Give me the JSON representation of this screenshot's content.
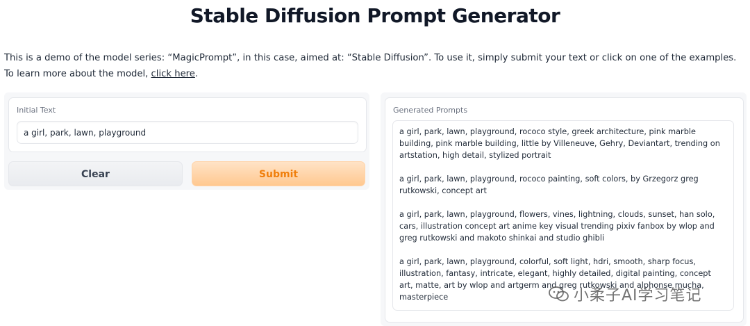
{
  "header": {
    "title": "Stable Diffusion Prompt Generator"
  },
  "description": {
    "text_before_link": "This is a demo of the model series: “MagicPrompt”, in this case, aimed at: “Stable Diffusion”. To use it, simply submit your text or click on one of the examples. To learn more about the model, ",
    "link_label": "click here",
    "text_after_link": "."
  },
  "input_panel": {
    "label": "Initial Text",
    "value": "a girl, park, lawn, playground",
    "clear_label": "Clear",
    "submit_label": "Submit"
  },
  "output_panel": {
    "label": "Generated Prompts",
    "prompts": [
      "a girl, park, lawn, playground, rococo style, greek architecture, pink marble building, pink marble building,  little by Villeneuve, Gehry, Deviantart, trending on artstation, high detail, stylized portrait",
      "a girl, park, lawn, playground, rococo painting, soft colors, by Grzegorz greg rutkowski, concept art",
      "a girl, park, lawn, playground, flowers, vines, lightning, clouds, sunset, han solo, cars, illustration concept art anime key visual trending pixiv fanbox by wlop and greg rutkowski and makoto shinkai and studio ghibli",
      "a girl, park, lawn, playground, colorful, soft light, hdri, smooth, sharp focus, illustration, fantasy, intricate, elegant, highly detailed, digital painting, concept art, matte, art by wlop and artgerm and greg rutkowski and alphonse mucha, masterpiece"
    ]
  },
  "watermark": {
    "text": "小柔子AI学习笔记",
    "icon": "wechat-icon"
  },
  "colors": {
    "submit_text": "#f07f0c",
    "submit_bg": "#ffc890",
    "panel_bg": "#f6f7f9"
  }
}
